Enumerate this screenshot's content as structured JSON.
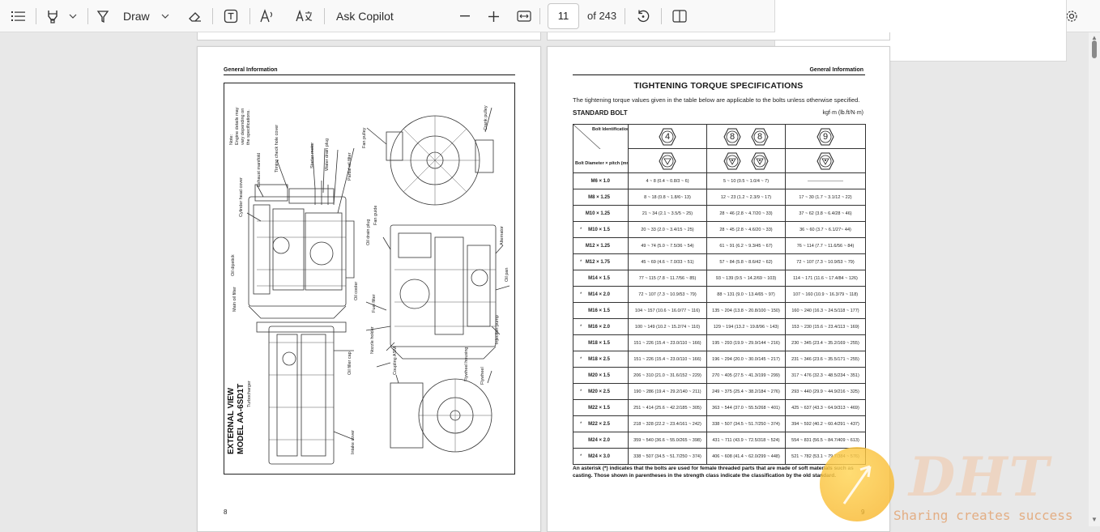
{
  "toolbar": {
    "draw_label": "Draw",
    "ask_copilot_label": "Ask Copilot",
    "page_current": "11",
    "page_total_label": "of 243"
  },
  "left_page": {
    "header": "General Information",
    "page_number": "8",
    "diagram": {
      "title_line1": "EXTERNAL VIEW",
      "title_line2": "MODEL AA-6SD1T",
      "note_line1": "Note:",
      "note_line2": "Engine details may",
      "note_line3": "vary depending on",
      "note_line4": "the specifications.",
      "labels": {
        "cylinder_head_cover": "Cylinder head cover",
        "exhaust_manifold": "Exhaust manifold",
        "timing_check_hole_cover": "Timing check hole cover",
        "starter_motor": "Starter motor",
        "water_drain_plug": "Water drain plug",
        "partial_oil_filter": "Partial oil filter",
        "fan_pulley": "Fan pulley",
        "crank_pulley": "Crank pulley",
        "oil_drain_plug": "Oil drain plug",
        "fan_guide": "Fan guide",
        "alternator": "Alternator",
        "oil_pan": "Oil pan",
        "oil_dipstick": "Oil dipstick",
        "main_oil_filter": "Main oil filter",
        "oil_cooler": "Oil cooler",
        "fuel_filter": "Fuel filter",
        "injection_pump": "Injection pump",
        "nozzle_holder": "Nozzle holder",
        "coupling_asm": "Coupling ASM",
        "flywheel_housing": "Flywheel housing",
        "flywheel": "Flywheel",
        "oil_filler_cap": "Oil filler cap",
        "turbocharger": "Turbocharger",
        "intake_cover": "Intake cover"
      }
    }
  },
  "right_page": {
    "header": "General Information",
    "page_number": "9",
    "title": "TIGHTENING TORQUE SPECIFICATIONS",
    "intro": "The tightening torque values given in the table below are applicable to the bolts unless otherwise specified.",
    "section": "STANDARD BOLT",
    "unit": "kgf·m (lb.ft/N·m)",
    "header_bolt_id": "Bolt Identification",
    "header_bolt_dia": "Bolt Diameter × pitch (mm)",
    "class_marks": [
      "4",
      "8",
      "8",
      "9"
    ],
    "rows": [
      {
        "ast": "",
        "dia": "M6 × 1.0",
        "c4": "4 ~ 8 (0.4 ~ 0.8/3 ~ 6)",
        "c8": "5 ~ 10 (0.5 ~ 1.0/4 ~ 7)",
        "c9": "————————"
      },
      {
        "ast": "",
        "dia": "M8 × 1.25",
        "c4": "8 ~ 18 (0.8 ~ 1.8/6~ 13)",
        "c8": "12 ~ 23 (1.2 ~ 2.3/9 ~ 17)",
        "c9": "17 ~ 30 (1.7 ~ 3.1/12 ~ 22)"
      },
      {
        "ast": "",
        "dia": "M10 × 1.25",
        "c4": "21 ~ 34 (2.1 ~ 3.5/5 ~ 25)",
        "c8": "28 ~ 46 (2.8 ~ 4.7/20 ~ 33)",
        "c9": "37 ~ 62 (3.8 ~ 6.4/28 ~ 46)"
      },
      {
        "ast": "*",
        "dia": "M10 × 1.5",
        "c4": "20 ~ 33 (2.0 ~ 3.4/15 ~ 25)",
        "c8": "28 ~ 45 (2.8 ~ 4.6/20 ~ 33)",
        "c9": "36 ~ 60 (3.7 ~ 6.1/27~ 44)"
      },
      {
        "ast": "",
        "dia": "M12 × 1.25",
        "c4": "49 ~ 74 (5.0 ~ 7.5/36 ~ 54)",
        "c8": "61 ~ 91 (6.2 ~ 9.3/45 ~ 67)",
        "c9": "76 ~ 114 (7.7 ~ 11.6/56 ~ 84)"
      },
      {
        "ast": "*",
        "dia": "M12 × 1.75",
        "c4": "45 ~ 69 (4.6 ~ 7.0/33 ~ 51)",
        "c8": "57 ~ 84 (5.8 ~ 8.6/42 ~ 62)",
        "c9": "72 ~ 107 (7.3 ~ 10.9/53 ~ 79)"
      },
      {
        "ast": "",
        "dia": "M14 × 1.5",
        "c4": "77 ~ 115 (7.8 ~ 11.7/56 ~ 85)",
        "c8": "93 ~ 139 (9.5 ~ 14.2/69 ~ 103)",
        "c9": "114 ~ 171 (11.6 ~ 17.4/84 ~ 126)"
      },
      {
        "ast": "*",
        "dia": "M14 × 2.0",
        "c4": "72 ~ 107 (7.3 ~ 10.9/53 ~ 79)",
        "c8": "88 ~ 131 (9.0 ~ 13.4/65 ~ 97)",
        "c9": "107 ~ 160 (10.9 ~ 16.3/79 ~ 118)"
      },
      {
        "ast": "",
        "dia": "M16 × 1.5",
        "c4": "104 ~ 157 (10.6 ~ 16.0/77 ~ 116)",
        "c8": "135 ~ 204 (13.8 ~ 20.8/100 ~ 150)",
        "c9": "160 ~ 240 (16.3 ~ 24.5/118 ~ 177)"
      },
      {
        "ast": "*",
        "dia": "M16 × 2.0",
        "c4": "100 ~ 149 (10.2 ~ 15.2/74 ~ 110)",
        "c8": "129 ~ 194 (13.2 ~ 19.8/96 ~ 143)",
        "c9": "153 ~ 230 (15.6 ~ 23.4/113 ~ 169)"
      },
      {
        "ast": "",
        "dia": "M18 × 1.5",
        "c4": "151 ~ 226 (15.4 ~ 23.0/110 ~ 166)",
        "c8": "195 ~ 293 (19.9 ~ 29.9/144 ~ 216)",
        "c9": "230 ~ 345 (23.4 ~ 35.2/169 ~ 255)"
      },
      {
        "ast": "*",
        "dia": "M18 × 2.5",
        "c4": "151 ~ 226 (15.4 ~ 23.0/110 ~ 166)",
        "c8": "196 ~ 294 (20.0 ~ 30.0/145 ~ 217)",
        "c9": "231 ~ 346 (23.6 ~ 35.5/171 ~ 255)"
      },
      {
        "ast": "",
        "dia": "M20 × 1.5",
        "c4": "206 ~ 310 (21.0 ~ 31.6/152 ~ 229)",
        "c8": "270 ~ 405 (27.5 ~ 41.3/199 ~ 299)",
        "c9": "317 ~ 476 (32.3 ~ 48.5/234 ~ 351)"
      },
      {
        "ast": "*",
        "dia": "M20 × 2.5",
        "c4": "190 ~ 286 (19.4 ~ 29.2/140 ~ 211)",
        "c8": "249 ~ 375 (25.4 ~ 38.2/184 ~ 276)",
        "c9": "293 ~ 440 (29.9 ~ 44.9/216 ~ 325)"
      },
      {
        "ast": "",
        "dia": "M22 × 1.5",
        "c4": "251 ~ 414 (25.6 ~ 42.2/185 ~ 305)",
        "c8": "363 ~ 544 (37.0 ~ 55.5/268 ~ 401)",
        "c9": "425 ~ 637 (43.3 ~ 64.9/313 ~ 469)"
      },
      {
        "ast": "*",
        "dia": "M22 × 2.5",
        "c4": "218 ~ 328 (22.2 ~ 23.4/161 ~ 242)",
        "c8": "338 ~ 507 (34.5 ~ 51.7/250 ~ 374)",
        "c9": "394 ~ 592 (40.2 ~ 60.4/291 ~ 437)"
      },
      {
        "ast": "",
        "dia": "M24 × 2.0",
        "c4": "359 ~ 540 (36.6 ~ 55.0/265 ~ 398)",
        "c8": "431 ~ 711 (43.9 ~ 72.5/318 ~ 524)",
        "c9": "554 ~ 831 (56.5 ~ 84.7/409 ~ 613)"
      },
      {
        "ast": "*",
        "dia": "M24 × 3.0",
        "c4": "338 ~ 507 (34.5 ~ 51.7/250 ~ 374)",
        "c8": "406 ~ 608 (41.4 ~ 62.0/299 ~ 448)",
        "c9": "521 ~ 782 (53.1 ~ 79.7/384 ~ 576)"
      }
    ],
    "footnote": "An asterisk (*) indicates that the bolts are used for female threaded parts that are made of soft materials such as casting. Those shown in parentheses in the strength class indicate the classification by the old standard."
  },
  "watermark": {
    "logo": "DHT",
    "tagline": "Sharing creates success"
  }
}
